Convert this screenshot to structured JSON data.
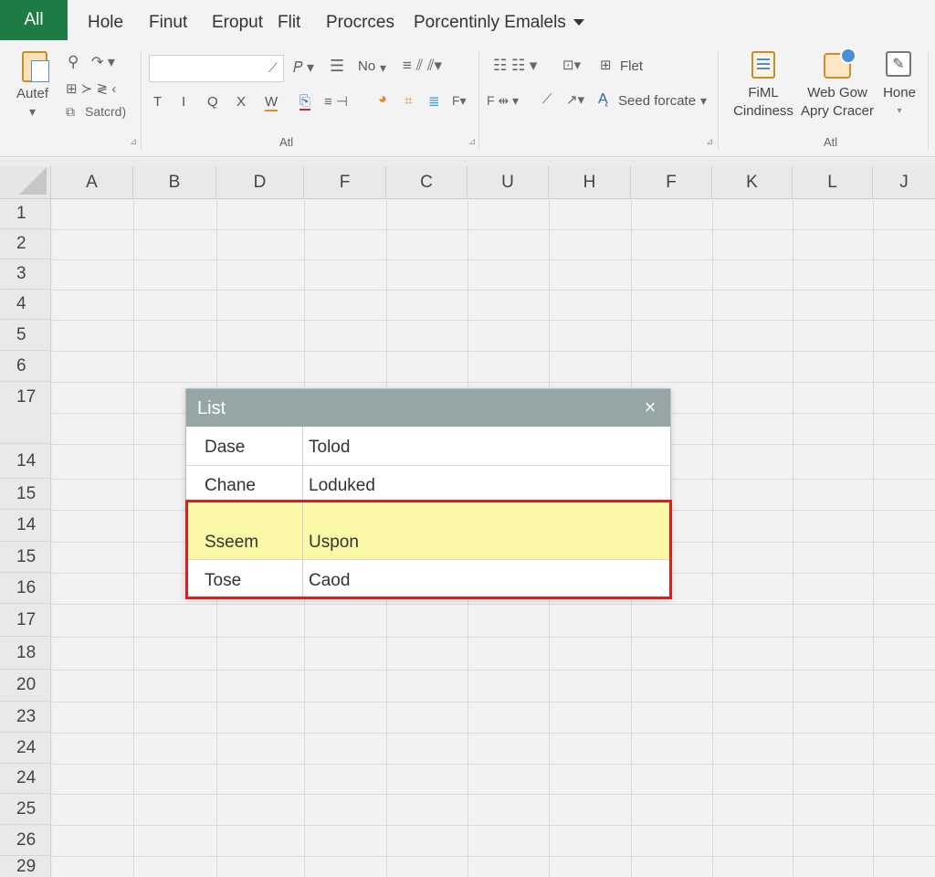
{
  "menubar": {
    "active_tab": "All",
    "items": [
      "Hole",
      "Finut",
      "Eroput",
      "Flit",
      "Procrces",
      "Porcentinly Emalels"
    ]
  },
  "ribbon": {
    "paste_label": "Autef",
    "clipboard_items": [
      "Satcrd)"
    ],
    "toolbar_row1": [
      "No"
    ],
    "toolbar_row2": [
      "T",
      "I",
      "Q",
      "X",
      "W"
    ],
    "filter_label": "Flet",
    "format_label": "Seed forcate",
    "group_label_1": "Atl",
    "group_label_2": "Atl",
    "big_buttons": [
      {
        "line1": "FiML",
        "line2": "Cindiness"
      },
      {
        "line1": "Web Gow",
        "line2": "Apry Cracer"
      },
      {
        "line1": "Hone",
        "line2": ""
      }
    ]
  },
  "columns": [
    "A",
    "B",
    "D",
    "F",
    "C",
    "U",
    "H",
    "F",
    "K",
    "L",
    "J"
  ],
  "rows": [
    "1",
    "2",
    "3",
    "4",
    "5",
    "6",
    "17",
    "14",
    "15",
    "14",
    "15",
    "16",
    "17",
    "18",
    "20",
    "23",
    "24",
    "24",
    "25",
    "26",
    "29"
  ],
  "dialog": {
    "title": "List",
    "close": "×",
    "rows": [
      {
        "name": "Dase",
        "value": "Tolod"
      },
      {
        "name": "Chane",
        "value": "Loduked"
      },
      {
        "name": "Sseem",
        "value": "Uspon"
      },
      {
        "name": "Tose",
        "value": "Caod"
      }
    ]
  },
  "colors": {
    "accent": "#1e7b45",
    "dialog_title_bg": "#96a6a6",
    "highlight": "#fbf8a8",
    "selection_border": "#e01d1d"
  }
}
